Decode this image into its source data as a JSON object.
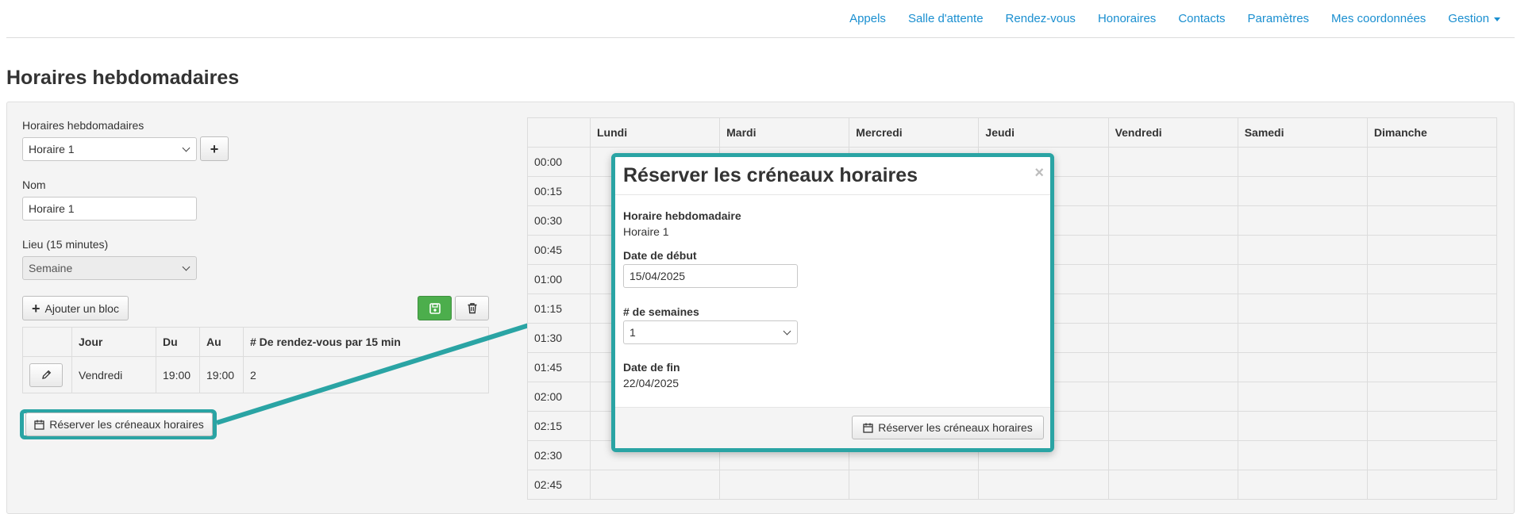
{
  "nav": {
    "items": [
      "Appels",
      "Salle d'attente",
      "Rendez-vous",
      "Honoraires",
      "Contacts",
      "Paramètres",
      "Mes coordonnées"
    ],
    "gestion": "Gestion"
  },
  "page": {
    "title": "Horaires hebdomadaires"
  },
  "form": {
    "schedule_label": "Horaires hebdomadaires",
    "schedule_value": "Horaire 1",
    "name_label": "Nom",
    "name_value": "Horaire 1",
    "place_label": "Lieu (15 minutes)",
    "place_value": "Semaine",
    "add_block_label": "Ajouter un bloc",
    "reserve_label": "Réserver les créneaux horaires"
  },
  "blocks_table": {
    "headers": [
      "",
      "Jour",
      "Du",
      "Au",
      "# De rendez-vous par 15 min"
    ],
    "rows": [
      {
        "day": "Vendredi",
        "from": "19:00",
        "to": "19:00",
        "count": "2"
      }
    ]
  },
  "calendar": {
    "days": [
      "Lundi",
      "Mardi",
      "Mercredi",
      "Jeudi",
      "Vendredi",
      "Samedi",
      "Dimanche"
    ],
    "times": [
      "00:00",
      "00:15",
      "00:30",
      "00:45",
      "01:00",
      "01:15",
      "01:30",
      "01:45",
      "02:00",
      "02:15",
      "02:30",
      "02:45"
    ]
  },
  "modal": {
    "title": "Réserver les créneaux horaires",
    "schedule_label": "Horaire hebdomadaire",
    "schedule_value": "Horaire 1",
    "start_label": "Date de début",
    "start_value": "15/04/2025",
    "weeks_label": "# de semaines",
    "weeks_value": "1",
    "end_label": "Date de fin",
    "end_value": "22/04/2025",
    "submit_label": "Réserver les créneaux horaires"
  },
  "colors": {
    "link": "#1a8fd0",
    "highlight": "#2aa4a4",
    "save": "#4cae4c"
  }
}
